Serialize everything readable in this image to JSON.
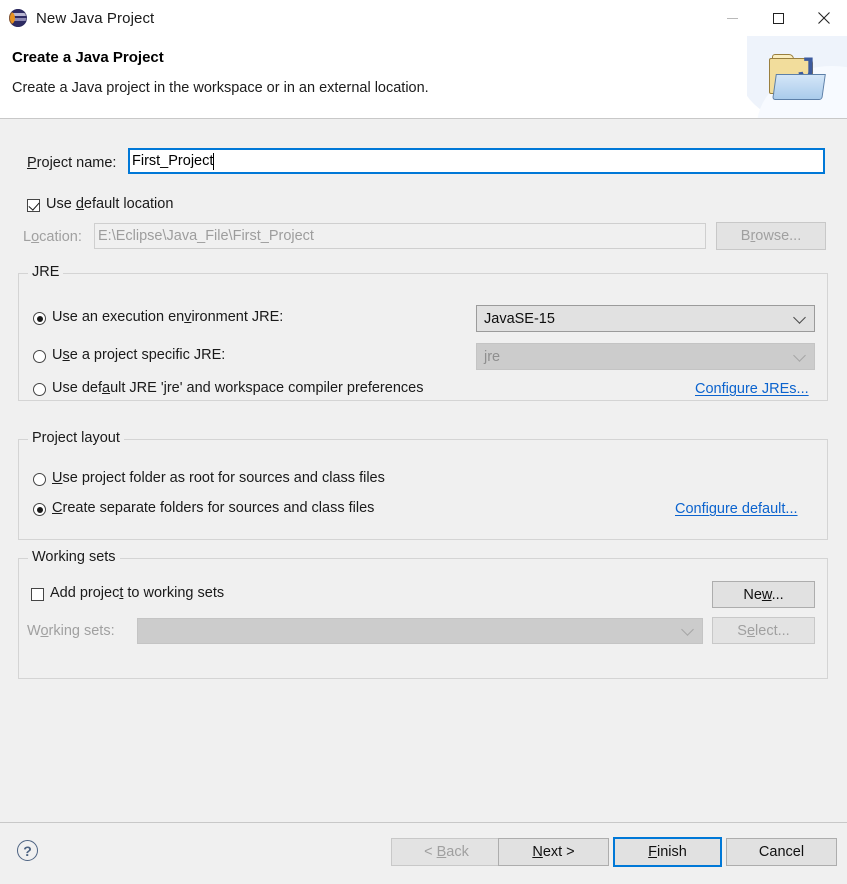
{
  "window": {
    "title": "New Java Project",
    "app_icon": "eclipse-globe-icon",
    "minimize_label": "Minimize",
    "maximize_label": "Maximize",
    "close_label": "Close"
  },
  "banner": {
    "title": "Create a Java Project",
    "subtitle": "Create a Java project in the workspace or in an external location.",
    "icon": "java-project-folder-icon",
    "java_mark": "J"
  },
  "project_name": {
    "label_pre": "P",
    "label_mn": "r",
    "label_post": "oject name:",
    "label_full": "Project name:",
    "value": "First_Project",
    "placeholder": ""
  },
  "use_default_location": {
    "label_pre": "Use ",
    "label_mn": "d",
    "label_post": "efault location",
    "label_full": "Use default location",
    "checked": true
  },
  "location": {
    "label_pre": "L",
    "label_mn": "o",
    "label_post": "cation:",
    "label_full": "Location:",
    "value": "E:\\Eclipse\\Java_File\\First_Project",
    "disabled": true,
    "browse_pre": "B",
    "browse_mn": "r",
    "browse_post": "owse...",
    "browse_full": "Browse...",
    "browse_disabled": true
  },
  "jre_group": {
    "title": "JRE",
    "option_exec_env": {
      "label_pre": "Use an en",
      "label_mn": "v",
      "label_post": "ironment JRE:",
      "label_full": "Use an execution environment JRE:",
      "label_a": "Use an execution en",
      "label_b": "ironment JRE:",
      "selected": true
    },
    "exec_env_combo": {
      "value": "JavaSE-15",
      "disabled": false
    },
    "option_project_jre": {
      "label_a": "U",
      "label_mn": "s",
      "label_b": "e a project specific JRE:",
      "label_full": "Use a project specific JRE:",
      "selected": false
    },
    "project_jre_combo": {
      "value": "jre",
      "disabled": true
    },
    "option_default_jre": {
      "label_a": "Use def",
      "label_mn": "a",
      "label_b": "ult JRE 'jre' and workspace compiler preferences",
      "label_full": "Use default JRE 'jre' and workspace compiler preferences",
      "selected": false
    },
    "configure_jres_link": "Configure JREs..."
  },
  "project_layout_group": {
    "title": "Project layout",
    "option_root": {
      "label_mn": "U",
      "label_b": "se project folder as root for sources and class files",
      "label_full": "Use project folder as root for sources and class files",
      "selected": false
    },
    "option_separate": {
      "label_mn": "C",
      "label_b": "reate separate folders for sources and class files",
      "label_full": "Create separate folders for sources and class files",
      "selected": true
    },
    "configure_default_link": "Configure default..."
  },
  "working_sets_group": {
    "title": "Working sets",
    "add_checkbox": {
      "label_a": "Add projec",
      "label_mn": "t",
      "label_b": " to working sets",
      "label_full": "Add project to working sets",
      "checked": false
    },
    "working_sets_label": {
      "label_a": "W",
      "label_mn": "o",
      "label_b": "rking sets:",
      "label_full": "Working sets:",
      "disabled": true
    },
    "working_sets_combo": {
      "value": "",
      "disabled": true
    },
    "new_button": {
      "label_a": "Ne",
      "label_mn": "w",
      "label_b": "...",
      "label_full": "New...",
      "disabled": false
    },
    "select_button": {
      "label_a": "S",
      "label_mn": "e",
      "label_b": "lect...",
      "label_full": "Select...",
      "disabled": true
    }
  },
  "footer": {
    "help_glyph": "?",
    "back_button": {
      "label_a": "< ",
      "label_mn": "B",
      "label_b": "ack",
      "label_full": "< Back",
      "disabled": true
    },
    "next_button": {
      "label_a": "",
      "label_mn": "N",
      "label_b": "ext >",
      "label_full": "Next >",
      "disabled": false
    },
    "finish_button": {
      "label_a": "",
      "label_mn": "F",
      "label_b": "inish",
      "label_full": "Finish",
      "is_default": true
    },
    "cancel_button": {
      "label_full": "Cancel"
    }
  },
  "colors": {
    "accent_blue": "#0078d7",
    "link_blue": "#0b63ce",
    "dialog_bg": "#f0f0f0",
    "header_bg": "#ffffff",
    "disabled_text": "#a0a0a0"
  }
}
